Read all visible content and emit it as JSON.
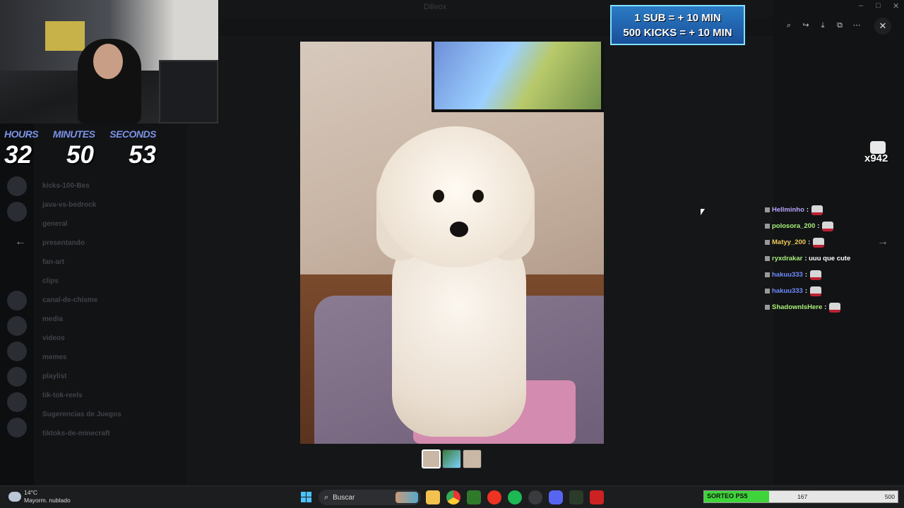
{
  "window": {
    "title": "Dilivox"
  },
  "background_channels": [
    "kicks-100-Bes",
    "java-vs-bedrock",
    "general",
    "presentando",
    "fan-art",
    "clips",
    "canal-de-chisme",
    "media",
    "videos",
    "memes",
    "playlist",
    "tik-tok-reels",
    "Sugerencias de Juegos",
    "tiktoks-de-minecraft"
  ],
  "timer": {
    "labels": {
      "hours": "HOURS",
      "minutes": "MINUTES",
      "seconds": "SECONDS"
    },
    "values": {
      "hours": "32",
      "minutes": "50",
      "seconds": "53"
    }
  },
  "sub_box": {
    "line1": "1 SUB = + 10 MIN",
    "line2": "500 KICKS = + 10 MIN"
  },
  "kick_badge": {
    "count": "x942"
  },
  "chat": [
    {
      "user": "Hellminho",
      "color": "#b8a6ff",
      "text": ":"
    },
    {
      "user": "polosora_200",
      "color": "#a8f07a",
      "text": ":"
    },
    {
      "user": "Matyy_200",
      "color": "#f0c85a",
      "text": ":"
    },
    {
      "user": "ryxdrakar",
      "color": "#a8f07a",
      "text": ": uuu que cute"
    },
    {
      "user": "hakuu333",
      "color": "#6e8cff",
      "text": ":"
    },
    {
      "user": "hakuu333",
      "color": "#6e8cff",
      "text": ":"
    },
    {
      "user": "ShadownIsHere",
      "color": "#a8f07a",
      "text": ":"
    }
  ],
  "viewer": {
    "tools": [
      "zoom-icon",
      "forward-icon",
      "download-icon",
      "open-external-icon",
      "more-icon"
    ],
    "prev_arrow": "←",
    "next_arrow": "→",
    "close": "✕"
  },
  "taskbar": {
    "weather_temp": "14°C",
    "weather_desc": "Mayorm. nublado",
    "search_placeholder": "Buscar"
  },
  "sorteo": {
    "label": "SORTEO PS5",
    "value": "167",
    "max": "500",
    "progress": 0.334
  }
}
